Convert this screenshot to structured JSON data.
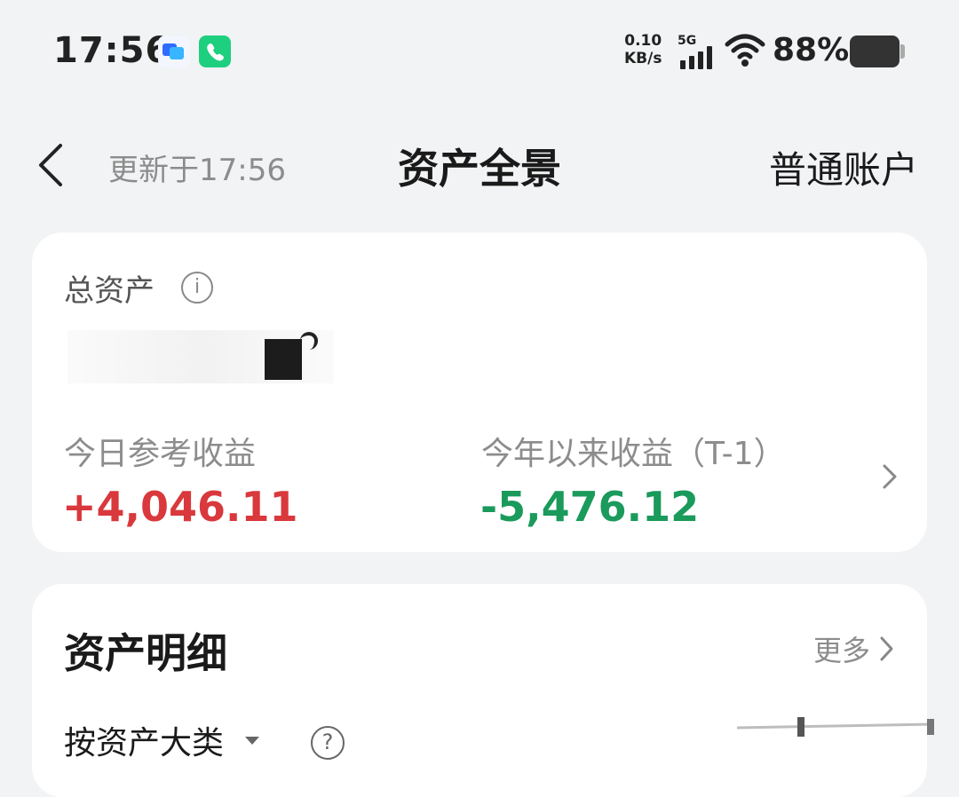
{
  "status_bar": {
    "time": "17:56",
    "net_speed_value": "0.10",
    "net_speed_unit": "KB/s",
    "net_type": "5G",
    "battery_percent": "88%"
  },
  "header": {
    "updated_text": "更新于17:56",
    "title": "资产全景",
    "account_type": "普通账户"
  },
  "summary": {
    "total_assets_label": "总资产",
    "today_label": "今日参考收益",
    "today_value": "+4,046.11",
    "ytd_label": "今年以来收益（T-1）",
    "ytd_value": "-5,476.12",
    "positive_color": "#d9383c",
    "negative_color": "#1a9a5b"
  },
  "detail": {
    "title": "资产明细",
    "more_label": "更多",
    "category_label": "按资产大类"
  }
}
